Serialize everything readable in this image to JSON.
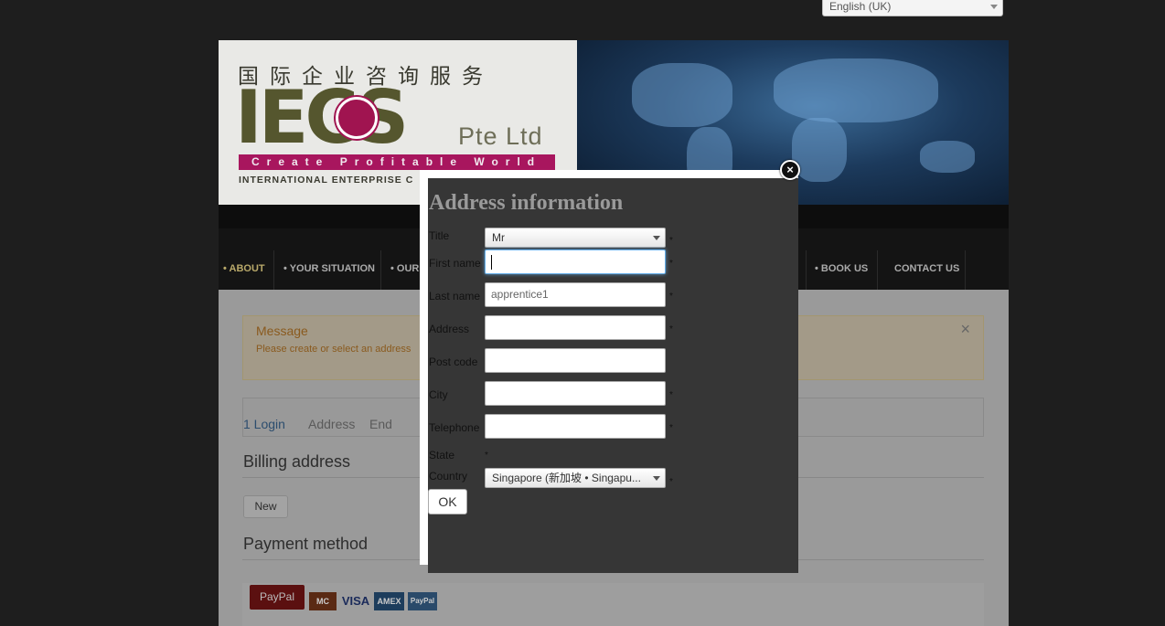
{
  "language_selector": {
    "value": "English (UK)"
  },
  "banner": {
    "chinese_name": "国际企业咨询服务",
    "logo_text": "IECS",
    "logo_suffix": "Pte Ltd",
    "slogan": "Create Profitable World",
    "company_line": "INTERNATIONAL ENTERPRISE C"
  },
  "nav": {
    "items": [
      {
        "label": "• ABOUT",
        "active": true
      },
      {
        "label": "• YOUR SITUATION"
      },
      {
        "label": "• OUR"
      },
      {
        "label": "• BOOK US"
      },
      {
        "label": "CONTACT US"
      }
    ]
  },
  "message": {
    "title": "Message",
    "text": "Please create or select an address",
    "close": "×"
  },
  "steps": [
    {
      "label": "1   Login",
      "current": true
    },
    {
      "label": "Address"
    },
    {
      "label": "End"
    }
  ],
  "billing": {
    "heading": "Billing address",
    "new_button": "New"
  },
  "payment": {
    "heading": "Payment method",
    "paypal": "PayPal",
    "cards": [
      "MC",
      "VISA",
      "AMEX",
      "PayPal"
    ]
  },
  "modal": {
    "title": "Address information",
    "close": "×",
    "required_mark": "*",
    "fields": {
      "title": {
        "label": "Title",
        "value": "Mr"
      },
      "first_name": {
        "label": "First name",
        "value": ""
      },
      "last_name": {
        "label": "Last name",
        "value": "apprentice1"
      },
      "address": {
        "label": "Address",
        "value": ""
      },
      "post_code": {
        "label": "Post code",
        "value": ""
      },
      "city": {
        "label": "City",
        "value": ""
      },
      "telephone": {
        "label": "Telephone",
        "value": ""
      },
      "state": {
        "label": "State"
      },
      "country": {
        "label": "Country",
        "value": "Singapore (新加坡 • Singapu..."
      }
    },
    "ok_button": "OK"
  },
  "colors": {
    "page_background": "#1e1e1e",
    "modal_background": "#363636",
    "accent_magenta": "#a8165e",
    "focus_blue": "#66afe9"
  }
}
